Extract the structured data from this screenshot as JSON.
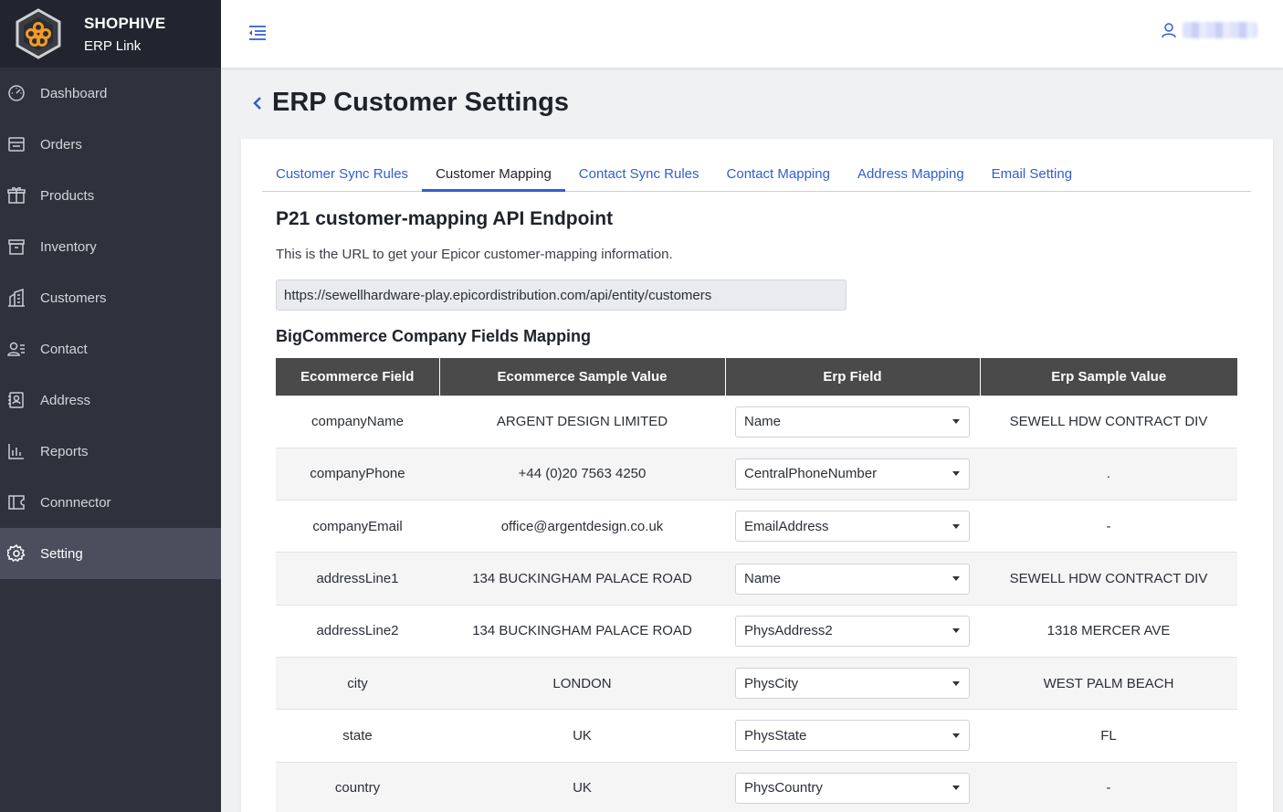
{
  "brand": {
    "name": "SHOPHIVE",
    "product": "ERP Link"
  },
  "sidebar": {
    "items": [
      {
        "label": "Dashboard",
        "icon": "dashboard-icon"
      },
      {
        "label": "Orders",
        "icon": "orders-icon"
      },
      {
        "label": "Products",
        "icon": "products-icon"
      },
      {
        "label": "Inventory",
        "icon": "inventory-icon"
      },
      {
        "label": "Customers",
        "icon": "customers-icon"
      },
      {
        "label": "Contact",
        "icon": "contact-icon"
      },
      {
        "label": "Address",
        "icon": "address-icon"
      },
      {
        "label": "Reports",
        "icon": "reports-icon"
      },
      {
        "label": "Connnector",
        "icon": "connector-icon"
      },
      {
        "label": "Setting",
        "icon": "gear-icon",
        "active": true
      }
    ]
  },
  "page": {
    "title": "ERP Customer Settings"
  },
  "tabs": [
    {
      "label": "Customer Sync Rules"
    },
    {
      "label": "Customer Mapping",
      "active": true
    },
    {
      "label": "Contact Sync Rules"
    },
    {
      "label": "Contact Mapping"
    },
    {
      "label": "Address Mapping"
    },
    {
      "label": "Email Setting"
    }
  ],
  "endpoint": {
    "title": "P21 customer-mapping API Endpoint",
    "description": "This is the URL to get your Epicor customer-mapping information.",
    "url": "https://sewellhardware-play.epicordistribution.com/api/entity/customers"
  },
  "mapping": {
    "title": "BigCommerce Company Fields Mapping",
    "headers": [
      "Ecommerce Field",
      "Ecommerce Sample Value",
      "Erp Field",
      "Erp Sample Value"
    ],
    "rows": [
      {
        "field": "companyName",
        "sample": "ARGENT DESIGN LIMITED",
        "erp_field": "Name",
        "erp_sample": "SEWELL HDW CONTRACT DIV"
      },
      {
        "field": "companyPhone",
        "sample": "+44 (0)20 7563 4250",
        "erp_field": "CentralPhoneNumber",
        "erp_sample": "."
      },
      {
        "field": "companyEmail",
        "sample": "office@argentdesign.co.uk",
        "erp_field": "EmailAddress",
        "erp_sample": "-"
      },
      {
        "field": "addressLine1",
        "sample": "134 BUCKINGHAM PALACE ROAD",
        "erp_field": "Name",
        "erp_sample": "SEWELL HDW CONTRACT DIV"
      },
      {
        "field": "addressLine2",
        "sample": "134 BUCKINGHAM PALACE ROAD",
        "erp_field": "PhysAddress2",
        "erp_sample": "1318 MERCER AVE"
      },
      {
        "field": "city",
        "sample": "LONDON",
        "erp_field": "PhysCity",
        "erp_sample": "WEST PALM BEACH"
      },
      {
        "field": "state",
        "sample": "UK",
        "erp_field": "PhysState",
        "erp_sample": "FL"
      },
      {
        "field": "country",
        "sample": "UK",
        "erp_field": "PhysCountry",
        "erp_sample": "-"
      }
    ]
  },
  "colors": {
    "sidebar": "#2f323d",
    "brand_bar": "#22252f",
    "active_item": "#4b4f5d",
    "accent": "#2f5fd0",
    "table_header": "#4a4a4a"
  }
}
